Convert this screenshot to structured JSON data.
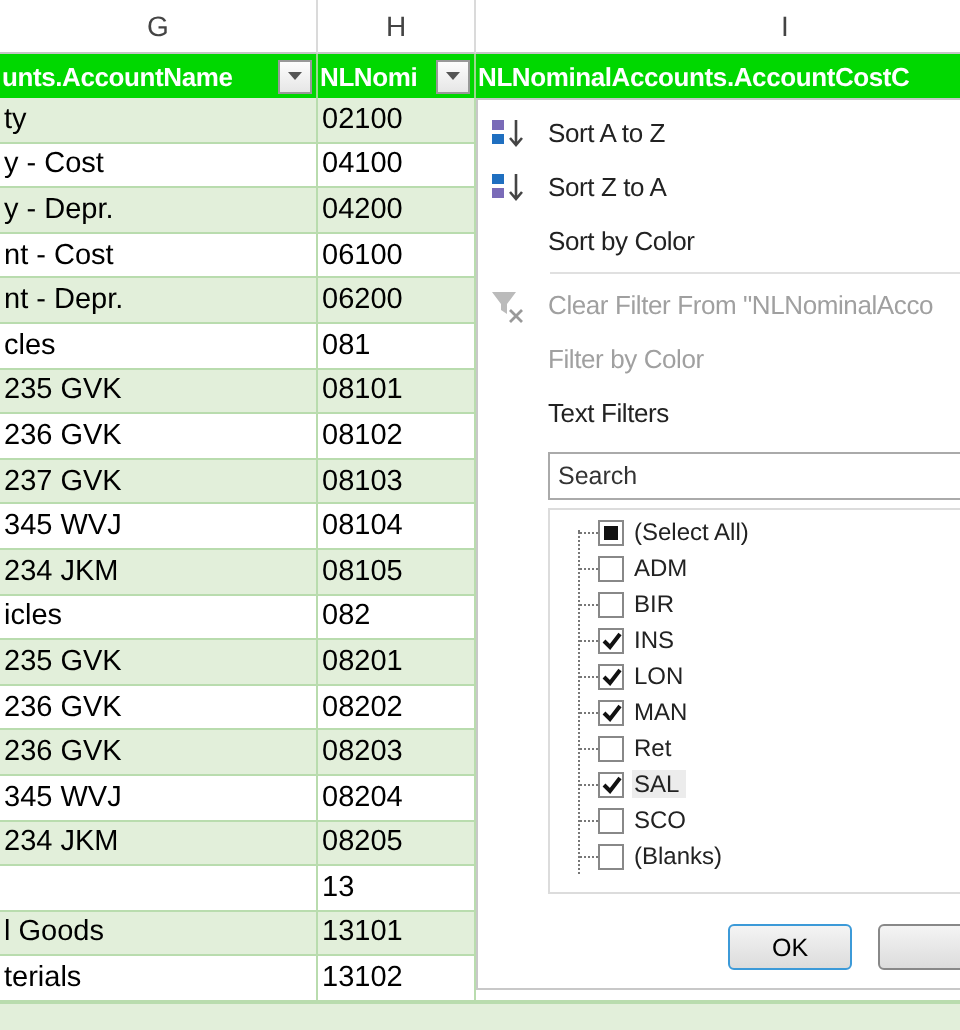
{
  "columns": [
    {
      "letter": "G",
      "header": "unts.AccountName",
      "filter_button": true
    },
    {
      "letter": "H",
      "header": "NLNomi",
      "filter_button": true
    },
    {
      "letter": "I",
      "header": "NLNominalAccounts.AccountCostC",
      "filter_button": false
    }
  ],
  "rows": [
    [
      "ty",
      "02100"
    ],
    [
      "y - Cost",
      "04100"
    ],
    [
      "y - Depr.",
      "04200"
    ],
    [
      "nt - Cost",
      "06100"
    ],
    [
      "nt - Depr.",
      "06200"
    ],
    [
      "cles",
      "081"
    ],
    [
      "235 GVK",
      "08101"
    ],
    [
      "236 GVK",
      "08102"
    ],
    [
      "237 GVK",
      "08103"
    ],
    [
      "345 WVJ",
      "08104"
    ],
    [
      "234 JKM",
      "08105"
    ],
    [
      "icles",
      "082"
    ],
    [
      "235 GVK",
      "08201"
    ],
    [
      "236 GVK",
      "08202"
    ],
    [
      "236 GVK",
      "08203"
    ],
    [
      "345 WVJ",
      "08204"
    ],
    [
      "234 JKM",
      "08205"
    ],
    [
      "",
      "13"
    ],
    [
      "l Goods",
      "13101"
    ],
    [
      "terials",
      "13102"
    ]
  ],
  "filter_menu": {
    "items": [
      {
        "kind": "sort-asc",
        "label": "Sort A to Z",
        "disabled": false
      },
      {
        "kind": "sort-desc",
        "label": "Sort Z to A",
        "disabled": false
      },
      {
        "kind": "plain",
        "label": "Sort by Color",
        "disabled": false
      },
      {
        "kind": "separator"
      },
      {
        "kind": "clear-filter",
        "label": "Clear Filter From \"NLNominalAcco",
        "disabled": true
      },
      {
        "kind": "plain",
        "label": "Filter by Color",
        "disabled": true
      },
      {
        "kind": "plain",
        "label": "Text Filters",
        "disabled": false
      }
    ],
    "search": {
      "placeholder": "Search"
    },
    "values": [
      {
        "label": "(Select All)",
        "checked": false,
        "indeterminate": true,
        "highlighted": false
      },
      {
        "label": "ADM",
        "checked": false,
        "highlighted": false
      },
      {
        "label": "BIR",
        "checked": false,
        "highlighted": false
      },
      {
        "label": "INS",
        "checked": true,
        "highlighted": false
      },
      {
        "label": "LON",
        "checked": true,
        "highlighted": false
      },
      {
        "label": "MAN",
        "checked": true,
        "highlighted": false
      },
      {
        "label": "Ret",
        "checked": false,
        "highlighted": false
      },
      {
        "label": "SAL",
        "checked": true,
        "highlighted": true
      },
      {
        "label": "SCO",
        "checked": false,
        "highlighted": false
      },
      {
        "label": "(Blanks)",
        "checked": false,
        "highlighted": false
      }
    ],
    "buttons": [
      {
        "kind": "ok",
        "label": "OK"
      },
      {
        "kind": "cancel"
      }
    ]
  }
}
